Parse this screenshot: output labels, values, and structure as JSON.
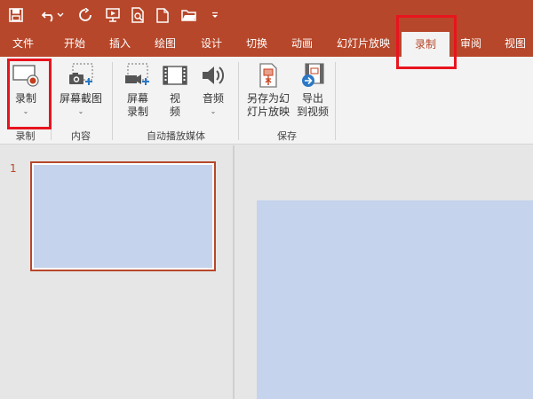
{
  "tabs": {
    "file": "文件",
    "home": "开始",
    "insert": "插入",
    "draw": "绘图",
    "design": "设计",
    "transitions": "切换",
    "animations": "动画",
    "slideshow": "幻灯片放映",
    "record": "录制",
    "review": "审阅",
    "view": "视图"
  },
  "ribbon": {
    "record_btn": "录制",
    "screenshot_btn": "屏幕截图",
    "screen_record_line1": "屏幕",
    "screen_record_line2": "录制",
    "video_line1": "视",
    "video_line2": "频",
    "audio_btn": "音频",
    "save_as_show_line1": "另存为幻",
    "save_as_show_line2": "灯片放映",
    "export_video_line1": "导出",
    "export_video_line2": "到视频",
    "group_record": "录制",
    "group_content": "内容",
    "group_automedia": "自动播放媒体",
    "group_save": "保存"
  },
  "slides": {
    "first_number": "1"
  },
  "colors": {
    "accent": "#b7472a",
    "slide_fill": "#c5d3ec",
    "highlight": "#e8141e"
  }
}
